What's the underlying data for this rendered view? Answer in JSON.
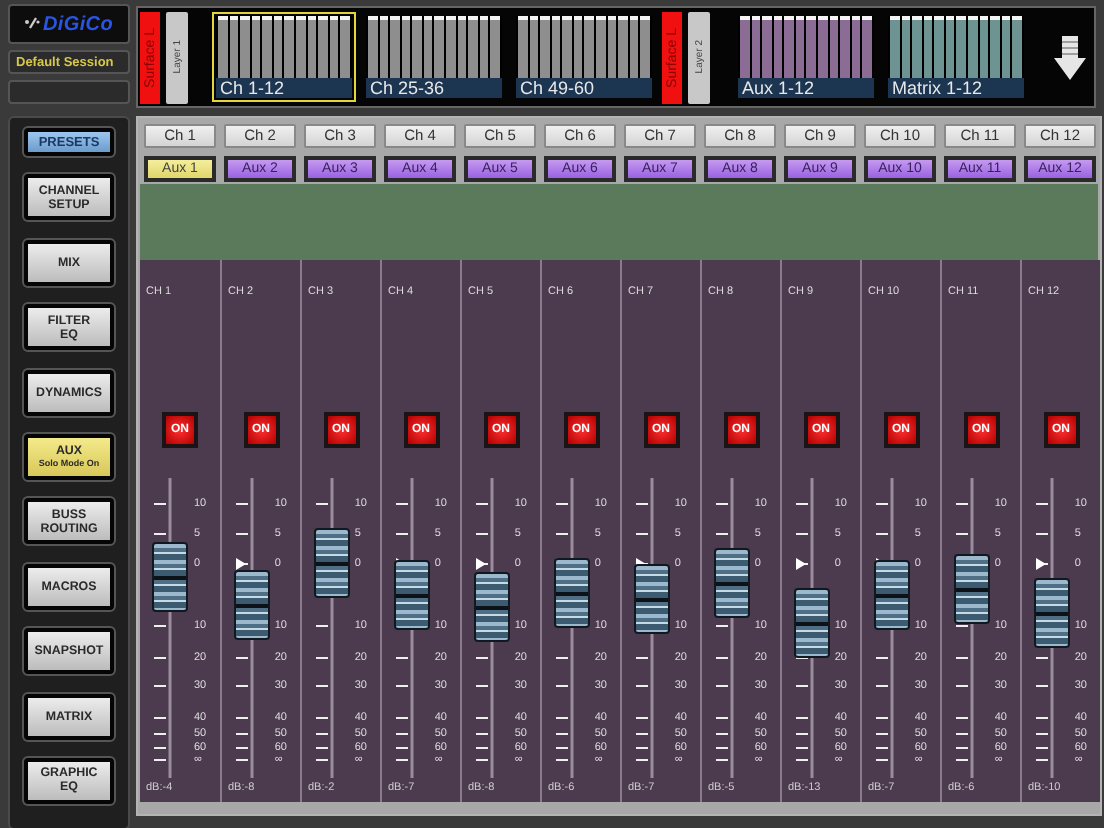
{
  "session": {
    "logo": "DiGiCo",
    "name": "Default Session"
  },
  "bank_strip": [
    {
      "kind": "surface",
      "label": "Surface L"
    },
    {
      "kind": "layer",
      "label": "Layer 1"
    },
    {
      "kind": "bank",
      "label": "Ch 1-12",
      "color": "#8e8e8e",
      "selected": true
    },
    {
      "kind": "bank",
      "label": "Ch 25-36",
      "color": "#8e8e8e",
      "selected": false
    },
    {
      "kind": "bank",
      "label": "Ch 49-60",
      "color": "#8e8e8e",
      "selected": false
    },
    {
      "kind": "surface",
      "label": "Surface L"
    },
    {
      "kind": "layer",
      "label": "Layer 2"
    },
    {
      "kind": "bank",
      "label": "Aux 1-12",
      "color": "#8a6c94",
      "selected": false
    },
    {
      "kind": "bank",
      "label": "Matrix 1-12",
      "color": "#6e9393",
      "selected": false
    },
    {
      "kind": "arrow"
    }
  ],
  "nav": [
    {
      "kind": "small",
      "lines": [
        "PRESETS"
      ],
      "selected": false
    },
    {
      "kind": "page",
      "lines": [
        "CHANNEL",
        "SETUP"
      ],
      "selected": false
    },
    {
      "kind": "page",
      "lines": [
        "MIX"
      ],
      "selected": false
    },
    {
      "kind": "page",
      "lines": [
        "FILTER",
        "EQ"
      ],
      "selected": false
    },
    {
      "kind": "page",
      "lines": [
        "DYNAMICS"
      ],
      "selected": false
    },
    {
      "kind": "page",
      "lines": [
        "AUX"
      ],
      "sublabel": "Solo Mode On",
      "selected": true
    },
    {
      "kind": "page",
      "lines": [
        "BUSS",
        "ROUTING"
      ],
      "selected": false
    },
    {
      "kind": "page",
      "lines": [
        "MACROS"
      ],
      "selected": false
    },
    {
      "kind": "page",
      "lines": [
        "SNAPSHOT"
      ],
      "selected": false
    },
    {
      "kind": "page",
      "lines": [
        "MATRIX"
      ],
      "selected": false
    },
    {
      "kind": "page",
      "lines": [
        "GRAPHIC",
        "EQ"
      ],
      "selected": false
    }
  ],
  "channels": [
    {
      "header": "Ch 1",
      "aux": {
        "label": "Aux 1",
        "selected": true
      },
      "name": "CH 1",
      "on": true,
      "on_label": "ON",
      "scale": [
        "10",
        "5",
        "0",
        "10",
        "20",
        "30",
        "40",
        "50",
        "60",
        "∞"
      ],
      "level": 0.67,
      "reading": "dB:-4"
    },
    {
      "header": "Ch 2",
      "aux": {
        "label": "Aux 2",
        "selected": false
      },
      "name": "CH 2",
      "on": true,
      "on_label": "ON",
      "scale": [
        "10",
        "5",
        "0",
        "10",
        "20",
        "30",
        "40",
        "50",
        "60",
        "∞"
      ],
      "level": 0.58,
      "reading": "dB:-8"
    },
    {
      "header": "Ch 3",
      "aux": {
        "label": "Aux 3",
        "selected": false
      },
      "name": "CH 3",
      "on": true,
      "on_label": "ON",
      "scale": [
        "10",
        "5",
        "0",
        "10",
        "20",
        "30",
        "40",
        "50",
        "60",
        "∞"
      ],
      "level": 0.72,
      "reading": "dB:-2"
    },
    {
      "header": "Ch 4",
      "aux": {
        "label": "Aux 4",
        "selected": false
      },
      "name": "CH 4",
      "on": true,
      "on_label": "ON",
      "scale": [
        "10",
        "5",
        "0",
        "10",
        "20",
        "30",
        "40",
        "50",
        "60",
        "∞"
      ],
      "level": 0.61,
      "reading": "dB:-7"
    },
    {
      "header": "Ch 5",
      "aux": {
        "label": "Aux 5",
        "selected": false
      },
      "name": "CH 5",
      "on": true,
      "on_label": "ON",
      "scale": [
        "10",
        "5",
        "0",
        "10",
        "20",
        "30",
        "40",
        "50",
        "60",
        "∞"
      ],
      "level": 0.57,
      "reading": "dB:-8"
    },
    {
      "header": "Ch 6",
      "aux": {
        "label": "Aux 6",
        "selected": false
      },
      "name": "CH 6",
      "on": true,
      "on_label": "ON",
      "scale": [
        "10",
        "5",
        "0",
        "10",
        "20",
        "30",
        "40",
        "50",
        "60",
        "∞"
      ],
      "level": 0.62,
      "reading": "dB:-6"
    },
    {
      "header": "Ch 7",
      "aux": {
        "label": "Aux 7",
        "selected": false
      },
      "name": "CH 7",
      "on": true,
      "on_label": "ON",
      "scale": [
        "10",
        "5",
        "0",
        "10",
        "20",
        "30",
        "40",
        "50",
        "60",
        "∞"
      ],
      "level": 0.6,
      "reading": "dB:-7"
    },
    {
      "header": "Ch 8",
      "aux": {
        "label": "Aux 8",
        "selected": false
      },
      "name": "CH 8",
      "on": true,
      "on_label": "ON",
      "scale": [
        "10",
        "5",
        "0",
        "10",
        "20",
        "30",
        "40",
        "50",
        "60",
        "∞"
      ],
      "level": 0.65,
      "reading": "dB:-5"
    },
    {
      "header": "Ch 9",
      "aux": {
        "label": "Aux 9",
        "selected": false
      },
      "name": "CH 9",
      "on": true,
      "on_label": "ON",
      "scale": [
        "10",
        "5",
        "0",
        "10",
        "20",
        "30",
        "40",
        "50",
        "60",
        "∞"
      ],
      "level": 0.52,
      "reading": "dB:-13"
    },
    {
      "header": "Ch 10",
      "aux": {
        "label": "Aux 10",
        "selected": false
      },
      "name": "CH 10",
      "on": true,
      "on_label": "ON",
      "scale": [
        "10",
        "5",
        "0",
        "10",
        "20",
        "30",
        "40",
        "50",
        "60",
        "∞"
      ],
      "level": 0.61,
      "reading": "dB:-7"
    },
    {
      "header": "Ch 11",
      "aux": {
        "label": "Aux 11",
        "selected": false
      },
      "name": "CH 11",
      "on": true,
      "on_label": "ON",
      "scale": [
        "10",
        "5",
        "0",
        "10",
        "20",
        "30",
        "40",
        "50",
        "60",
        "∞"
      ],
      "level": 0.63,
      "reading": "dB:-6"
    },
    {
      "header": "Ch 12",
      "aux": {
        "label": "Aux 12",
        "selected": false
      },
      "name": "CH 12",
      "on": true,
      "on_label": "ON",
      "scale": [
        "10",
        "5",
        "0",
        "10",
        "20",
        "30",
        "40",
        "50",
        "60",
        "∞"
      ],
      "level": 0.55,
      "reading": "dB:-10"
    }
  ]
}
